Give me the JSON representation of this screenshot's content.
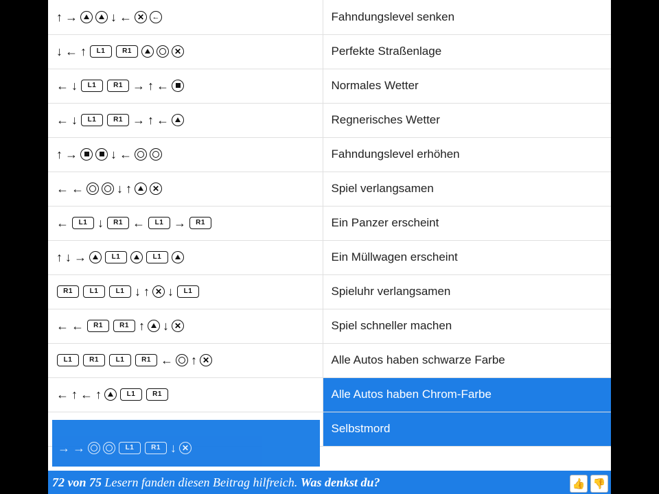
{
  "buttons": {
    "L1": "L1",
    "R1": "R1"
  },
  "rows": [
    {
      "label": "Fahndungslevel senken",
      "inputs": [
        "up",
        "right",
        "tri",
        "tri",
        "down",
        "left",
        "x",
        "lf"
      ]
    },
    {
      "label": "Perfekte Straßenlage",
      "inputs": [
        "down",
        "left",
        "up",
        "L1",
        "R1",
        "tri",
        "o",
        "x"
      ]
    },
    {
      "label": "Normales Wetter",
      "inputs": [
        "left",
        "down",
        "L1",
        "R1",
        "right",
        "up",
        "left",
        "sq"
      ]
    },
    {
      "label": "Regnerisches Wetter",
      "inputs": [
        "left",
        "down",
        "L1",
        "R1",
        "right",
        "up",
        "left",
        "tri"
      ]
    },
    {
      "label": "Fahndungslevel erhöhen",
      "inputs": [
        "up",
        "right",
        "sq",
        "sq",
        "down",
        "left",
        "o",
        "o"
      ]
    },
    {
      "label": "Spiel verlangsamen",
      "inputs": [
        "left",
        "left",
        "o",
        "o",
        "down",
        "up",
        "tri",
        "x"
      ]
    },
    {
      "label": "Ein Panzer erscheint",
      "inputs": [
        "left",
        "L1",
        "down",
        "R1",
        "left",
        "L1",
        "right",
        "R1"
      ]
    },
    {
      "label": "Ein Müllwagen erscheint",
      "inputs": [
        "up",
        "down",
        "right",
        "tri",
        "L1",
        "tri",
        "L1",
        "tri"
      ]
    },
    {
      "label": "Spieluhr verlangsamen",
      "inputs": [
        "R1",
        "L1",
        "L1",
        "down",
        "up",
        "x",
        "down",
        "L1"
      ]
    },
    {
      "label": "Spiel schneller machen",
      "inputs": [
        "left",
        "left",
        "R1",
        "R1",
        "up",
        "tri",
        "down",
        "x"
      ]
    },
    {
      "label": "Alle Autos haben schwarze Farbe",
      "inputs": [
        "L1",
        "R1",
        "L1",
        "R1",
        "left",
        "o",
        "up",
        "x"
      ]
    },
    {
      "label": "Alle Autos haben Chrom-Farbe",
      "highlight": true,
      "inputs": [
        "left",
        "up",
        "left",
        "up",
        "tri",
        "L1",
        "R1"
      ]
    },
    {
      "label": "Selbstmord",
      "highlight": true,
      "inputs_overlay": true,
      "inputs": [
        "right",
        "right",
        "o",
        "o",
        "L1",
        "R1",
        "down",
        "x"
      ]
    }
  ],
  "footer": {
    "prefix": "72 von 75",
    "mid": "Lesern fanden diesen Beitrag hilfreich.",
    "ask": "Was denkst du?"
  }
}
